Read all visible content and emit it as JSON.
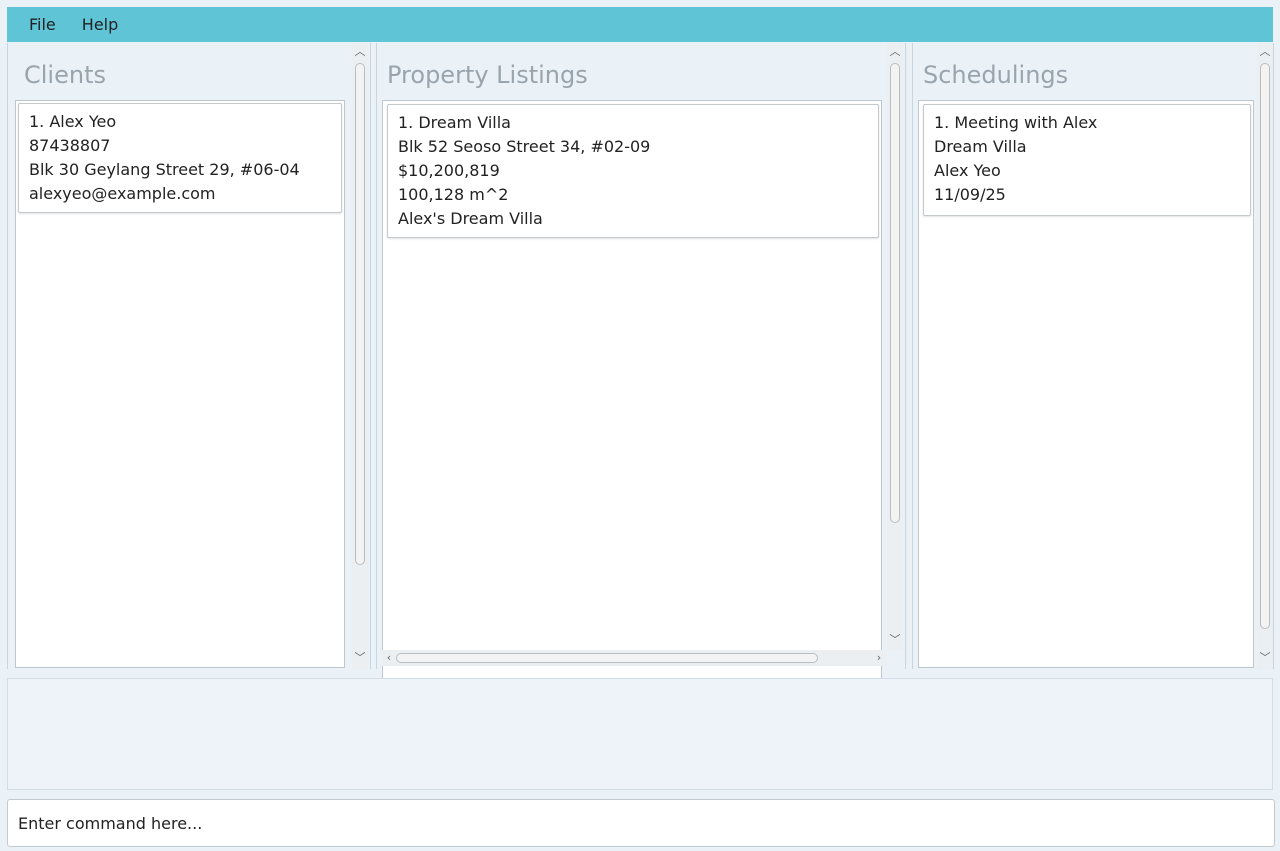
{
  "menubar": {
    "items": [
      {
        "label": "File"
      },
      {
        "label": "Help"
      }
    ]
  },
  "clients": {
    "title": "Clients",
    "items": [
      {
        "lines": [
          "1. Alex Yeo",
          "87438807",
          "Blk 30 Geylang Street 29, #06-04",
          "alexyeo@example.com"
        ]
      }
    ]
  },
  "listings": {
    "title": "Property Listings",
    "items": [
      {
        "lines": [
          "1. Dream Villa",
          "Blk 52 Seoso Street 34, #02-09",
          "$10,200,819",
          "100,128 m^2",
          "Alex's Dream Villa"
        ]
      }
    ]
  },
  "schedulings": {
    "title": "Schedulings",
    "items": [
      {
        "lines": [
          "1. Meeting with Alex",
          "Dream Villa",
          "Alex Yeo",
          "11/09/25"
        ]
      }
    ]
  },
  "result": {
    "text": ""
  },
  "command": {
    "placeholder": "Enter command here...",
    "value": ""
  },
  "icons": {
    "scroll_up": "chevron-up-icon",
    "scroll_down": "chevron-down-icon",
    "scroll_left": "chevron-left-icon",
    "scroll_right": "chevron-right-icon"
  },
  "colors": {
    "menubar": "#5fc5d6",
    "background": "#eaf2f8",
    "title": "#9aa4ad"
  }
}
